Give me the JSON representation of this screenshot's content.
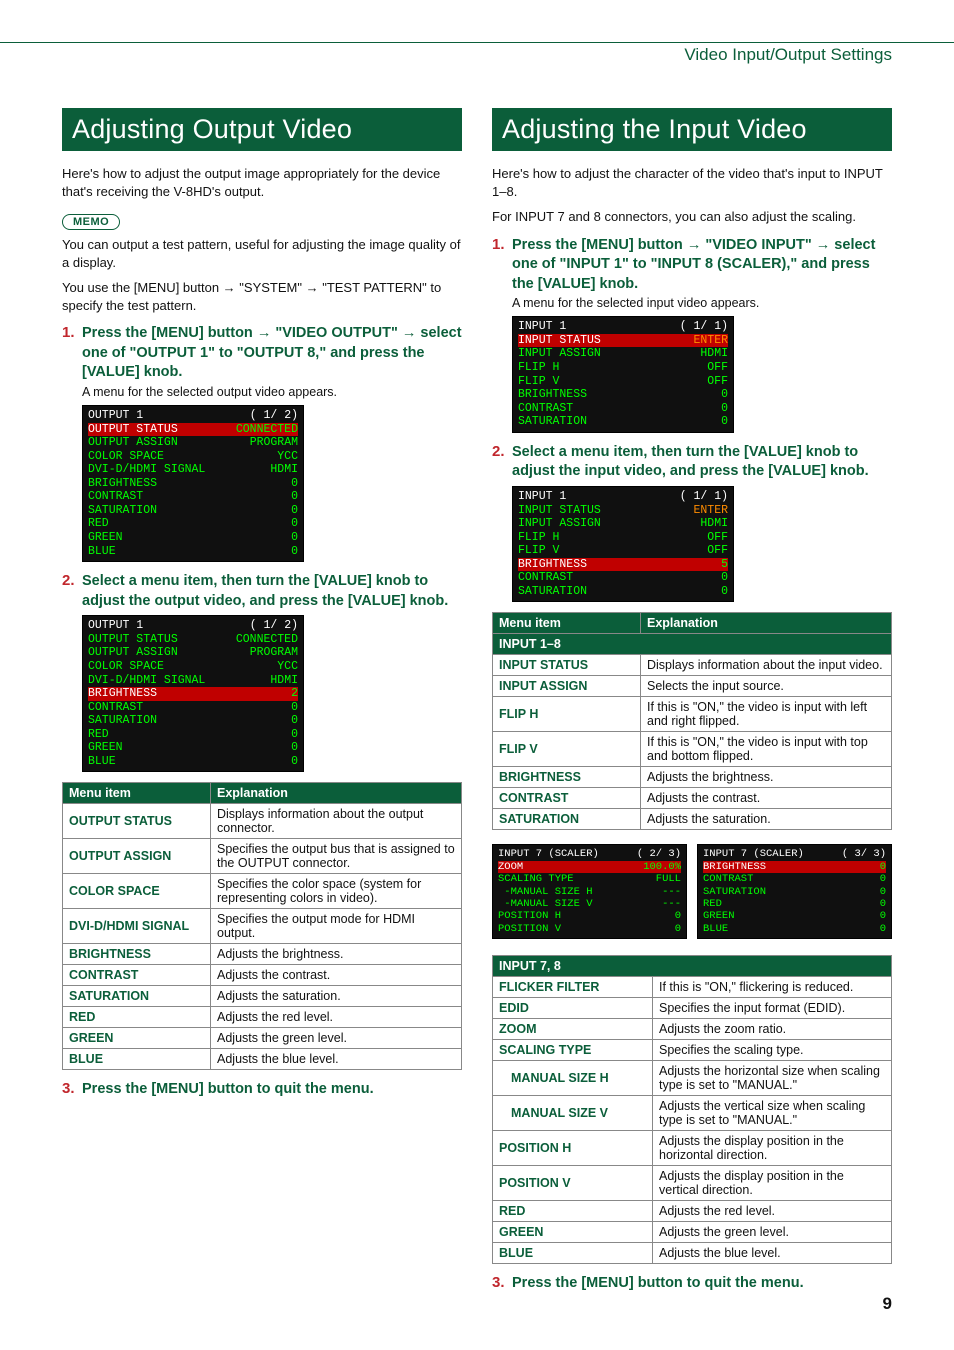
{
  "section": "Video Input/Output Settings",
  "page_number": "9",
  "left": {
    "heading": "Adjusting Output Video",
    "intro": "Here's how to adjust the output image appropriately for the device that's receiving the V-8HD's output.",
    "memo_label": "MEMO",
    "memo_p1": "You can output a test pattern, useful for adjusting the image quality of a display.",
    "memo_p2_prefix": "You use the [MENU] button ",
    "memo_p2_mid1": " \"SYSTEM\" ",
    "memo_p2_suffix": " \"TEST PATTERN\" to specify the test pattern.",
    "step1_prefix": "Press the [MENU] button ",
    "step1_mid": " \"VIDEO OUTPUT\" ",
    "step1_rest": " select one of \"OUTPUT 1\" to \"OUTPUT 8,\" and press the [VALUE] knob.",
    "step1_sub": "A menu for the selected output video appears.",
    "osd1": {
      "title": "OUTPUT 1",
      "page": "( 1/ 2)",
      "rows": [
        {
          "k": "OUTPUT STATUS",
          "v": "CONNECTED",
          "sel": true
        },
        {
          "k": "OUTPUT ASSIGN",
          "v": "PROGRAM"
        },
        {
          "k": "COLOR SPACE",
          "v": "YCC"
        },
        {
          "k": "DVI-D/HDMI SIGNAL",
          "v": "HDMI"
        },
        {
          "k": "BRIGHTNESS",
          "v": "0"
        },
        {
          "k": "CONTRAST",
          "v": "0"
        },
        {
          "k": "SATURATION",
          "v": "0"
        },
        {
          "k": "RED",
          "v": "0"
        },
        {
          "k": "GREEN",
          "v": "0"
        },
        {
          "k": "BLUE",
          "v": "0"
        }
      ]
    },
    "step2": "Select a menu item, then turn the [VALUE] knob to adjust the output video, and press the [VALUE] knob.",
    "osd2": {
      "title": "OUTPUT 1",
      "page": "( 1/ 2)",
      "rows": [
        {
          "k": "OUTPUT STATUS",
          "v": "CONNECTED"
        },
        {
          "k": "OUTPUT ASSIGN",
          "v": "PROGRAM"
        },
        {
          "k": "COLOR SPACE",
          "v": "YCC"
        },
        {
          "k": "DVI-D/HDMI SIGNAL",
          "v": "HDMI"
        },
        {
          "k": "BRIGHTNESS",
          "v": "2",
          "sel": true
        },
        {
          "k": "CONTRAST",
          "v": "0"
        },
        {
          "k": "SATURATION",
          "v": "0"
        },
        {
          "k": "RED",
          "v": "0"
        },
        {
          "k": "GREEN",
          "v": "0"
        },
        {
          "k": "BLUE",
          "v": "0"
        }
      ]
    },
    "table": {
      "head": [
        "Menu item",
        "Explanation"
      ],
      "rows": [
        [
          "OUTPUT STATUS",
          "Displays information about the output connector."
        ],
        [
          "OUTPUT ASSIGN",
          "Specifies the output bus that is assigned to the OUTPUT connector."
        ],
        [
          "COLOR SPACE",
          "Specifies the color space (system for representing colors in video)."
        ],
        [
          "DVI-D/HDMI SIGNAL",
          "Specifies the output mode for HDMI output."
        ],
        [
          "BRIGHTNESS",
          "Adjusts the brightness."
        ],
        [
          "CONTRAST",
          "Adjusts the contrast."
        ],
        [
          "SATURATION",
          "Adjusts the saturation."
        ],
        [
          "RED",
          "Adjusts the red level."
        ],
        [
          "GREEN",
          "Adjusts the green level."
        ],
        [
          "BLUE",
          "Adjusts the blue level."
        ]
      ]
    },
    "step3": "Press the [MENU] button to quit the menu."
  },
  "right": {
    "heading": "Adjusting the Input Video",
    "intro1": "Here's how to adjust the character of the video that's input to INPUT 1–8.",
    "intro2": "For INPUT 7 and 8 connectors, you can also adjust the scaling.",
    "step1_prefix": "Press the [MENU] button ",
    "step1_mid": " \"VIDEO INPUT\" ",
    "step1_rest": " select one of \"INPUT 1\" to \"INPUT 8 (SCALER),\" and press the [VALUE] knob.",
    "step1_sub": "A menu for the selected input video appears.",
    "osd1": {
      "title": "INPUT 1",
      "page": "( 1/ 1)",
      "rows": [
        {
          "k": "INPUT STATUS",
          "v": "ENTER",
          "sel": true,
          "enter": true
        },
        {
          "k": "INPUT ASSIGN",
          "v": "HDMI"
        },
        {
          "k": "FLIP H",
          "v": "OFF"
        },
        {
          "k": "FLIP V",
          "v": "OFF"
        },
        {
          "k": "BRIGHTNESS",
          "v": "0"
        },
        {
          "k": "CONTRAST",
          "v": "0"
        },
        {
          "k": "SATURATION",
          "v": "0"
        }
      ]
    },
    "step2": "Select a menu item, then turn the [VALUE] knob to adjust the input video, and press the [VALUE] knob.",
    "osd2": {
      "title": "INPUT 1",
      "page": "( 1/ 1)",
      "rows": [
        {
          "k": "INPUT STATUS",
          "v": "ENTER",
          "enter": true
        },
        {
          "k": "INPUT ASSIGN",
          "v": "HDMI"
        },
        {
          "k": "FLIP H",
          "v": "OFF"
        },
        {
          "k": "FLIP V",
          "v": "OFF"
        },
        {
          "k": "BRIGHTNESS",
          "v": "5",
          "sel": true
        },
        {
          "k": "CONTRAST",
          "v": "0"
        },
        {
          "k": "SATURATION",
          "v": "0"
        }
      ]
    },
    "table1": {
      "head": [
        "Menu item",
        "Explanation"
      ],
      "cat": "INPUT 1–8",
      "rows": [
        [
          "INPUT STATUS",
          "Displays information about the input video."
        ],
        [
          "INPUT ASSIGN",
          "Selects the input source."
        ],
        [
          "FLIP H",
          "If this is \"ON,\" the video is input with left and right flipped."
        ],
        [
          "FLIP V",
          "If this is \"ON,\" the video is input with top and bottom flipped."
        ],
        [
          "BRIGHTNESS",
          "Adjusts the brightness."
        ],
        [
          "CONTRAST",
          "Adjusts the contrast."
        ],
        [
          "SATURATION",
          "Adjusts the saturation."
        ]
      ]
    },
    "osd3a": {
      "title": "INPUT 7 (SCALER)",
      "page": "( 2/ 3)",
      "rows": [
        {
          "k": "ZOOM",
          "v": "100.0%",
          "sel": true
        },
        {
          "k": "SCALING TYPE",
          "v": "FULL"
        },
        {
          "k": " -MANUAL SIZE H",
          "v": "---"
        },
        {
          "k": " -MANUAL SIZE V",
          "v": "---"
        },
        {
          "k": "POSITION H",
          "v": "0"
        },
        {
          "k": "POSITION V",
          "v": "0"
        }
      ]
    },
    "osd3b": {
      "title": "INPUT 7 (SCALER)",
      "page": "( 3/ 3)",
      "rows": [
        {
          "k": "BRIGHTNESS",
          "v": "0",
          "sel": true
        },
        {
          "k": "CONTRAST",
          "v": "0"
        },
        {
          "k": "SATURATION",
          "v": "0"
        },
        {
          "k": "RED",
          "v": "0"
        },
        {
          "k": "GREEN",
          "v": "0"
        },
        {
          "k": "BLUE",
          "v": "0"
        }
      ]
    },
    "table2": {
      "cat": "INPUT 7, 8",
      "rows": [
        [
          "FLICKER FILTER",
          "If this is \"ON,\" flickering is reduced.",
          ""
        ],
        [
          "EDID",
          "Specifies the input format (EDID).",
          ""
        ],
        [
          "ZOOM",
          "Adjusts the zoom ratio.",
          ""
        ],
        [
          "SCALING TYPE",
          "Specifies the scaling type.",
          ""
        ],
        [
          "MANUAL SIZE H",
          "Adjusts the horizontal size when scaling type is set to \"MANUAL.\"",
          "indent"
        ],
        [
          "MANUAL SIZE V",
          "Adjusts the vertical size when scaling type is set to \"MANUAL.\"",
          "indent"
        ],
        [
          "POSITION H",
          "Adjusts the display position in the horizontal direction.",
          ""
        ],
        [
          "POSITION V",
          "Adjusts the display position in the vertical direction.",
          ""
        ],
        [
          "RED",
          "Adjusts the red level.",
          ""
        ],
        [
          "GREEN",
          "Adjusts the green level.",
          ""
        ],
        [
          "BLUE",
          "Adjusts the blue level.",
          ""
        ]
      ]
    },
    "step3": "Press the [MENU] button to quit the menu."
  }
}
